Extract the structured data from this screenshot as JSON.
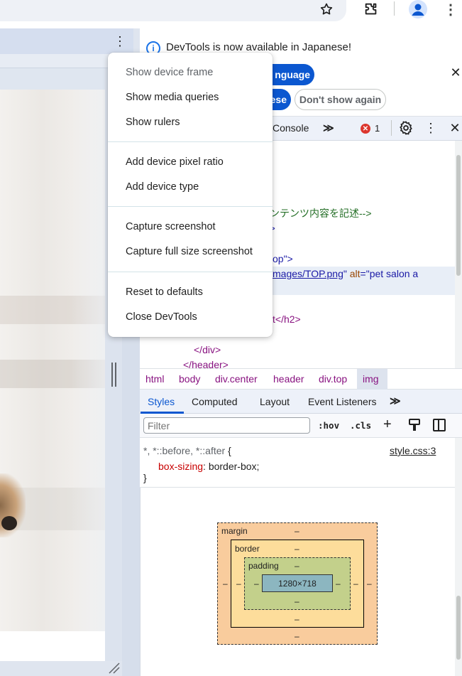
{
  "devtools": {
    "infobar": {
      "message": "DevTools is now available in Japanese!",
      "always_match_label": "nguage",
      "switch_label": "ese",
      "dont_show_label": "Don't show again"
    },
    "toolbar": {
      "console_tab": "Console",
      "more_tabs": "≫",
      "error_count": "1"
    },
    "elements": {
      "lines": [
        {
          "parts": [
            {
              "t": "コンテンツ内容を記述-->",
              "c": "c-comment"
            }
          ]
        },
        {
          "parts": [
            {
              "t": "r\">",
              "c": "c-val"
            }
          ]
        },
        {
          "parts": [
            {
              "t": "op\">",
              "c": "c-val"
            }
          ]
        },
        {
          "parts": [
            {
              "t": "mages/TOP.png",
              "c": "c-link"
            },
            {
              "t": "\" ",
              "c": "c-val"
            },
            {
              "t": "alt",
              "c": "c-attr"
            },
            {
              "t": "=\"pet salon a",
              "c": "c-val"
            }
          ]
        },
        {
          "parts": [
            {
              "t": "t</h2>",
              "c": "c-tag"
            }
          ]
        },
        {
          "parts": [
            {
              "t": "</div>",
              "c": "c-tag"
            }
          ]
        },
        {
          "parts": [
            {
              "t": "</header>",
              "c": "c-tag"
            }
          ]
        }
      ]
    },
    "breadcrumbs": [
      "html",
      "body",
      "div.center",
      "header",
      "div.top",
      "img"
    ],
    "styles_tabs": [
      "Styles",
      "Computed",
      "Layout",
      "Event Listeners"
    ],
    "styles_more": "≫",
    "filter_placeholder": "Filter",
    "hov_label": ":hov",
    "cls_label": ".cls",
    "rule": {
      "selector": "*, *::before, *::after",
      "open_brace": "{",
      "source": "style.css:3",
      "property": "box-sizing",
      "value": "border-box;",
      "close_brace": "}"
    },
    "box_model": {
      "margin_label": "margin",
      "border_label": "border",
      "padding_label": "padding",
      "content_size": "1280×718",
      "dash": "–"
    }
  },
  "context_menu": {
    "items": [
      {
        "label": "Show device frame",
        "enabled": false
      },
      {
        "label": "Show media queries",
        "enabled": true
      },
      {
        "label": "Show rulers",
        "enabled": true
      },
      {
        "label": "Add device pixel ratio",
        "enabled": true
      },
      {
        "label": "Add device type",
        "enabled": true
      },
      {
        "label": "Capture screenshot",
        "enabled": true
      },
      {
        "label": "Capture full size screenshot",
        "enabled": true
      },
      {
        "label": "Reset to defaults",
        "enabled": true
      },
      {
        "label": "Close DevTools",
        "enabled": true
      }
    ]
  },
  "colors": {
    "accent": "#0b57d0",
    "error": "#dc362e",
    "margin": "#f9cc9d",
    "border": "#fddd9b",
    "padding": "#c3d08b",
    "content": "#8cb6c0"
  }
}
